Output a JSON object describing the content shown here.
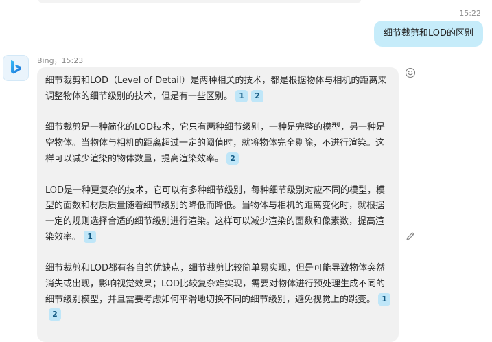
{
  "user_message": {
    "time": "15:22",
    "text": "细节裁剪和LOD的区别"
  },
  "bot_message": {
    "author": "Bing",
    "separator": "，",
    "time": "15:23",
    "paragraphs": [
      {
        "text": "细节裁剪和LOD（Level of Detail）是两种相关的技术，都是根据物体与相机的距离来调整物体的细节级别的技术，但是有一些区别。",
        "citations": [
          "1",
          "2"
        ]
      },
      {
        "text": "细节裁剪是一种简化的LOD技术，它只有两种细节级别，一种是完整的模型，另一种是空物体。当物体与相机的距离超过一定的阈值时，就将物体完全剔除，不进行渲染。这样可以减少渲染的物体数量，提高渲染效率。",
        "citations": [
          "2"
        ]
      },
      {
        "text": "LOD是一种更复杂的技术，它可以有多种细节级别，每种细节级别对应不同的模型，模型的面数和材质质量随着细节级别的降低而降低。当物体与相机的距离变化时，就根据一定的规则选择合适的细节级别进行渲染。这样可以减少渲染的面数和像素数，提高渲染效率。",
        "citations": [
          "1"
        ]
      },
      {
        "text": "细节裁剪和LOD都有各自的优缺点，细节裁剪比较简单易实现，但是可能导致物体突然消失或出现，影响视觉效果；LOD比较复杂难实现，需要对物体进行预处理生成不同的细节级别模型，并且需要考虑如何平滑地切换不同的细节级别，避免视觉上的跳变。",
        "citations": [
          "1",
          "2"
        ]
      }
    ]
  },
  "icons": {
    "avatar": "bing-logo-icon",
    "reaction": "smiley-icon",
    "edit": "pencil-icon"
  },
  "colors": {
    "user_bubble": "#c6ecfa",
    "bot_bubble": "#f1f1f1",
    "citation_bg": "#bfe6f8",
    "citation_text": "#135a83",
    "meta_text": "#8a8a8a"
  }
}
